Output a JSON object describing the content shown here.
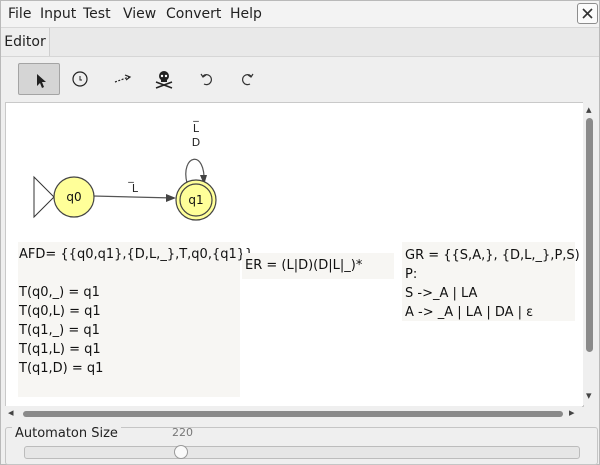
{
  "menubar": {
    "items": [
      "File",
      "Input",
      "Test",
      "View",
      "Convert",
      "Help"
    ]
  },
  "tabs": [
    {
      "label": "Editor"
    }
  ],
  "toolbar": {
    "tools": [
      {
        "name": "attribute-editor",
        "icon": "cursor-arrow-icon",
        "active": true
      },
      {
        "name": "state-creator",
        "icon": "state-creator-icon",
        "active": false
      },
      {
        "name": "transition-creator",
        "icon": "transition-creator-icon",
        "active": false
      },
      {
        "name": "deleter",
        "icon": "skull-deleter-icon",
        "active": false
      },
      {
        "name": "undo",
        "icon": "undo-icon",
        "active": false
      },
      {
        "name": "redo",
        "icon": "redo-icon",
        "active": false
      }
    ]
  },
  "automaton": {
    "states": [
      {
        "id": "q0",
        "label": "q0",
        "initial": true,
        "final": false
      },
      {
        "id": "q1",
        "label": "q1",
        "initial": false,
        "final": true
      }
    ],
    "transitions": [
      {
        "from": "q0",
        "to": "q1",
        "labels": [
          "_",
          "L"
        ]
      },
      {
        "from": "q1",
        "to": "q1",
        "labels": [
          "_",
          "L",
          "D"
        ]
      }
    ],
    "state_fill": "#ffff99"
  },
  "afd_panel": {
    "title": "AFD= {{q0,q1},{D,L,_},T,q0,{q1}}",
    "lines": [
      "T(q0,_) = q1",
      "T(q0,L) = q1",
      "T(q1,_) = q1",
      "T(q1,L) = q1",
      "T(q1,D) = q1"
    ]
  },
  "er_panel": {
    "text": "ER = (L|D)(D|L|_)*"
  },
  "gr_panel": {
    "lines": [
      "GR = {{S,A,}, {D,L,_},P,S)",
      "P:",
      "S ->_A | LA",
      "A -> _A | LA | DA | ε"
    ]
  },
  "automaton_size": {
    "label": "Automaton Size",
    "value": "220"
  }
}
